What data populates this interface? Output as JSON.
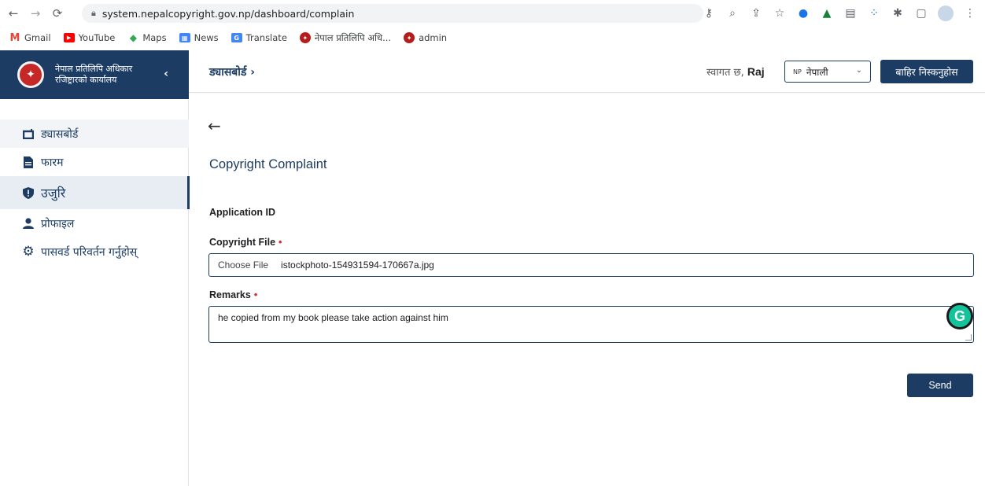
{
  "browser": {
    "url": "system.nepalcopyright.gov.np/dashboard/complain",
    "bookmarks": [
      {
        "label": "Gmail"
      },
      {
        "label": "YouTube"
      },
      {
        "label": "Maps"
      },
      {
        "label": "News"
      },
      {
        "label": "Translate"
      },
      {
        "label": "नेपाल प्रतिलिपि अधि..."
      },
      {
        "label": "admin"
      }
    ]
  },
  "sidebar": {
    "org_name": "नेपाल प्रतिलिपि अधिकार रजिष्ट्रारको कार्यालय",
    "collapse_glyph": "‹",
    "items": [
      {
        "label": "ड्यासबोर्ड",
        "icon": "dashboard-icon"
      },
      {
        "label": "फारम",
        "icon": "file-icon"
      },
      {
        "label": "उजुरि",
        "icon": "shield-icon"
      },
      {
        "label": "प्रोफाइल",
        "icon": "user-icon"
      },
      {
        "label": "पासवर्ड परिवर्तन गर्नुहोस्",
        "icon": "gear-icon"
      }
    ]
  },
  "topbar": {
    "breadcrumb": "ड्यासबोर्ड ›",
    "welcome_prefix": "स्वागत छ,",
    "user_name": "Raj",
    "lang_code": "NP",
    "lang_label": "नेपाली",
    "logout_label": "बाहिर निस्कनुहोस"
  },
  "main": {
    "back_glyph": "←",
    "title": "Copyright Complaint",
    "application_id_label": "Application ID",
    "copyright_file_label": "Copyright File",
    "required_marker": "•",
    "choose_file_label": "Choose File",
    "file_name": "istockphoto-154931594-170667a.jpg",
    "remarks_label": "Remarks",
    "remarks_value": "he copied from my book please take action against him",
    "send_label": "Send"
  },
  "colors": {
    "brand": "#1c3c63",
    "required": "#d32f2f",
    "grammarly": "#15c39a"
  }
}
